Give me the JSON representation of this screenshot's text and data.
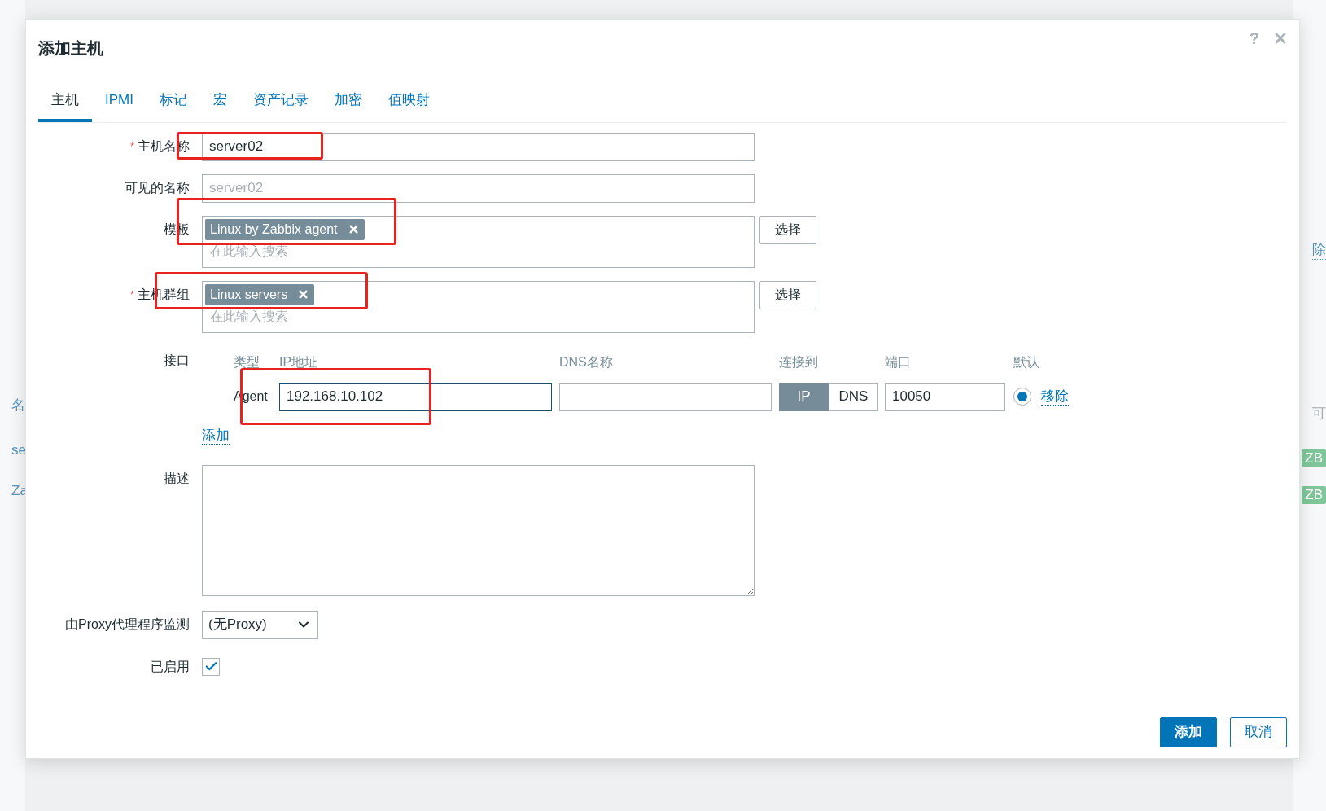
{
  "background_page": {
    "left_items": [
      "名",
      "se",
      "Za"
    ],
    "right_items": [
      {
        "text": "除",
        "kind": "link"
      },
      {
        "text": "可",
        "kind": "header"
      },
      {
        "text": "ZB",
        "kind": "tag"
      },
      {
        "text": "ZB",
        "kind": "tag"
      }
    ]
  },
  "dialog": {
    "title": "添加主机",
    "help": "?",
    "tabs": [
      {
        "label": "主机",
        "selected": true
      },
      {
        "label": "IPMI",
        "selected": false
      },
      {
        "label": "标记",
        "selected": false
      },
      {
        "label": "宏",
        "selected": false
      },
      {
        "label": "资产记录",
        "selected": false
      },
      {
        "label": "加密",
        "selected": false
      },
      {
        "label": "值映射",
        "selected": false
      }
    ],
    "host_name": {
      "label": "主机名称",
      "required_mark": "*",
      "value": "server02"
    },
    "visible_name": {
      "label": "可见的名称",
      "placeholder": "server02"
    },
    "templates": {
      "label": "模板",
      "tags": [
        "Linux by Zabbix agent"
      ],
      "placeholder": "在此输入搜索",
      "button": "选择"
    },
    "host_groups": {
      "label": "主机群组",
      "required_mark": "*",
      "tags": [
        "Linux servers"
      ],
      "placeholder": "在此输入搜索",
      "button": "选择"
    },
    "interfaces": {
      "label": "接口",
      "columns": [
        "类型",
        "IP地址",
        "DNS名称",
        "连接到",
        "端口",
        "默认"
      ],
      "rows": [
        {
          "type": "Agent",
          "ip": "192.168.10.102",
          "focused": true,
          "connect_to": [
            {
              "label": "IP",
              "selected": true
            },
            {
              "label": "DNS",
              "selected": false
            }
          ],
          "port": "10050",
          "default": true,
          "remove": "移除"
        }
      ],
      "add_link": "添加"
    },
    "description": {
      "label": "描述"
    },
    "proxy": {
      "label": "由Proxy代理程序监测",
      "value": "(无Proxy)"
    },
    "enabled": {
      "label": "已启用",
      "checked": true
    },
    "buttons": [
      {
        "label": "添加",
        "kind": "primary"
      },
      {
        "label": "取消",
        "kind": "secondary"
      }
    ]
  }
}
